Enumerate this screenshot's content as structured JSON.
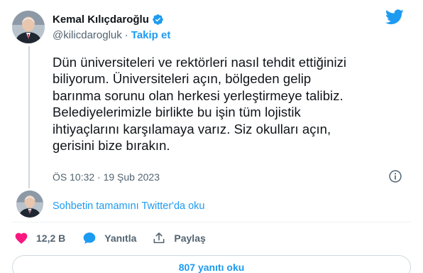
{
  "author": {
    "display_name": "Kemal Kılıçdaroğlu",
    "handle": "@kilicdarogluk",
    "separator": "·",
    "follow_label": "Takip et"
  },
  "tweet": {
    "lines": [
      "Dün üniversiteleri ve rektörleri nasıl tehdit ettiğinizi",
      "biliyorum. Üniversiteleri açın, bölgeden gelip",
      "barınma sorunu olan herkesi yerleştirmeye talibiz.",
      "Belediyelerimizle birlikte bu işin tüm lojistik",
      "ihtiyaçlarını karşılamaya varız. Siz okulları açın,",
      "gerisini bize bırakın."
    ],
    "timestamp": "ÖS 10:32 · 19 Şub 2023"
  },
  "thread": {
    "read_more": "Sohbetin tamamını Twitter'da oku"
  },
  "actions": {
    "likes": "12,2 B",
    "reply": "Yanıtla",
    "share": "Paylaş"
  },
  "replies_button": "807 yanıtı oku",
  "colors": {
    "accent": "#1d9bf0",
    "like": "#f91880",
    "muted": "#536471"
  },
  "icons": [
    "verified-badge-icon",
    "twitter-bird-icon",
    "info-icon",
    "heart-icon",
    "reply-icon",
    "share-icon"
  ]
}
